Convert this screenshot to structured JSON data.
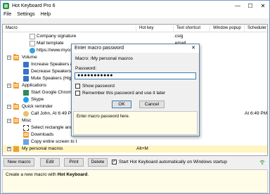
{
  "window": {
    "title": "Hot Keyboard Pro 6"
  },
  "menubar": {
    "items": [
      "File",
      "Settings",
      "Help"
    ]
  },
  "columns": {
    "macro": "Macro",
    "hotkey": "Hot key",
    "text_shortcut": "Text shortcut",
    "window_popup": "Window popup",
    "scheduler": "Scheduler"
  },
  "tree": {
    "rows": [
      {
        "label": "Company signature",
        "hotkey": "",
        "text_shortcut": ".csig",
        "scheduler": ""
      },
      {
        "label": "Mail template",
        "hotkey": "",
        "text_shortcut": ".email",
        "scheduler": ""
      },
      {
        "label": "https://www.myco",
        "hotkey": "",
        "text_shortcut": "",
        "scheduler": ""
      },
      {
        "label": "Volume",
        "hotkey": "",
        "text_shortcut": "",
        "scheduler": ""
      },
      {
        "label": "Increase Speakers (High",
        "hotkey": "",
        "text_shortcut": "",
        "scheduler": ""
      },
      {
        "label": "Decrease Speakers (High",
        "hotkey": "",
        "text_shortcut": "",
        "scheduler": ""
      },
      {
        "label": "Mute Speakers (High D",
        "hotkey": "",
        "text_shortcut": "",
        "scheduler": ""
      },
      {
        "label": "Applications",
        "hotkey": "",
        "text_shortcut": "",
        "scheduler": ""
      },
      {
        "label": "Start Google Chrome",
        "hotkey": "",
        "text_shortcut": "",
        "scheduler": ""
      },
      {
        "label": "Skype",
        "hotkey": "",
        "text_shortcut": "",
        "scheduler": ""
      },
      {
        "label": "Quick reminder",
        "hotkey": "",
        "text_shortcut": "",
        "scheduler": ""
      },
      {
        "label": "Call John, At 6:49 PM,",
        "hotkey": "",
        "text_shortcut": "",
        "scheduler": "At 6:49 PM,"
      },
      {
        "label": "Misc",
        "hotkey": "",
        "text_shortcut": "",
        "scheduler": ""
      },
      {
        "label": "Select rectangle and c",
        "hotkey": "",
        "text_shortcut": "",
        "scheduler": ""
      },
      {
        "label": "Downloads",
        "hotkey": "",
        "text_shortcut": "",
        "scheduler": ""
      },
      {
        "label": "Copy entire screen to t",
        "hotkey": "",
        "text_shortcut": "",
        "scheduler": ""
      },
      {
        "label": "My personal macros",
        "hotkey": "Alt+M",
        "text_shortcut": "",
        "scheduler": ""
      }
    ]
  },
  "buttons": {
    "new_macro": "New macro",
    "edit": "Edit",
    "print": "Print",
    "delete": "Delete",
    "startup_label": "Start Hot Keyboard automatically on Windows startup",
    "startup_checked": "✓"
  },
  "info": {
    "prefix": "Create a new macro with ",
    "app": "Hot Keyboard",
    "suffix": "."
  },
  "dialog": {
    "title": "Enter macro password",
    "close": "✕",
    "macro_line": "Macro: /My personal macros",
    "password_label": "Password:",
    "password_value": "●●●●●●●●●●●",
    "show_password": "Show password",
    "remember": "Remember this password and use it later",
    "ok": "OK",
    "cancel": "Cancel",
    "hint": "Enter macro password here."
  },
  "colors": {
    "selection": "#fff5c2",
    "accent": "#3c7fb1",
    "folder": "#f0a030"
  }
}
